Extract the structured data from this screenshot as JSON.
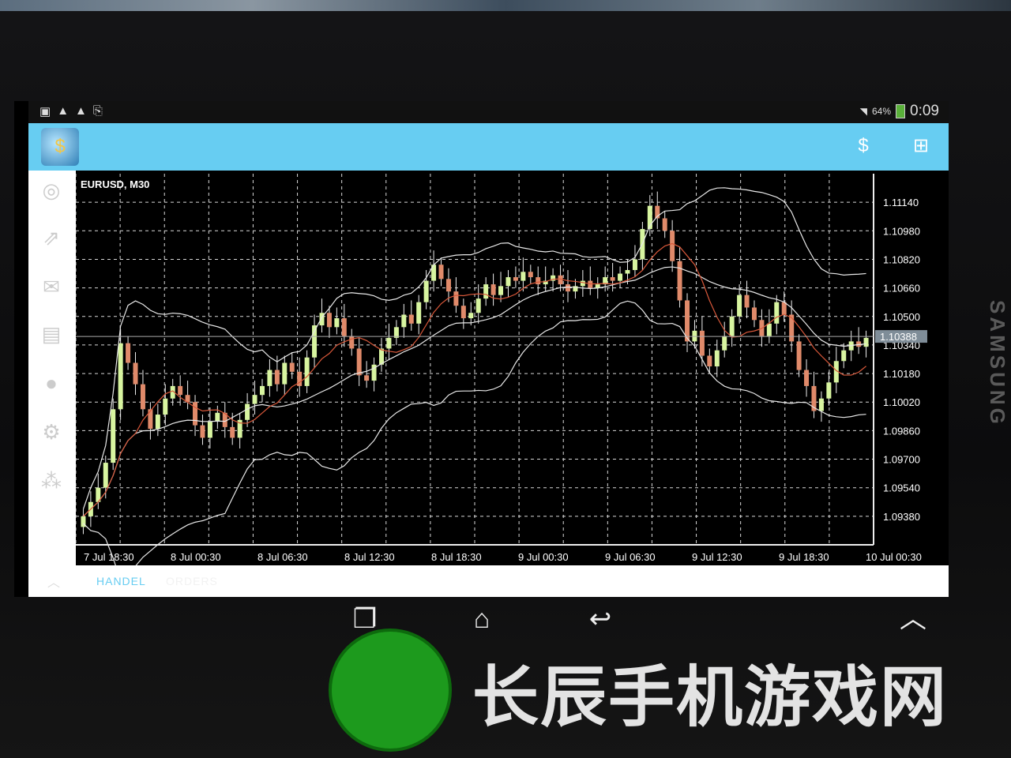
{
  "status_bar": {
    "battery": "64%",
    "time": "0:09"
  },
  "chart_data": {
    "type": "candlestick",
    "symbol_label": "EURUSD, M30",
    "y_ticks": [
      "1.11140",
      "1.10980",
      "1.10820",
      "1.10660",
      "1.10500",
      "1.10340",
      "1.10180",
      "1.10020",
      "1.09860",
      "1.09700",
      "1.09540",
      "1.09380"
    ],
    "x_ticks": [
      "7 Jul 18:30",
      "8 Jul 00:30",
      "8 Jul 06:30",
      "8 Jul 12:30",
      "8 Jul 18:30",
      "9 Jul 00:30",
      "9 Jul 06:30",
      "9 Jul 12:30",
      "9 Jul 18:30",
      "10 Jul 00:30"
    ],
    "current_price": "1.10388",
    "ylim": [
      1.0922,
      1.113
    ],
    "grid": true,
    "colors": {
      "bull": "#d8f5a0",
      "bear": "#e08a6a",
      "bands": "#e8e8e8",
      "ma": "#d9583a"
    },
    "close_prices": [
      1.0938,
      1.0946,
      1.0954,
      1.0968,
      1.0998,
      1.1035,
      1.1024,
      1.1012,
      1.0998,
      1.0987,
      1.0995,
      1.1004,
      1.1011,
      1.1006,
      1.1002,
      1.0989,
      1.0982,
      1.0991,
      1.0996,
      1.0988,
      1.0982,
      1.0992,
      1.1001,
      1.1006,
      1.1011,
      1.102,
      1.1012,
      1.1024,
      1.1019,
      1.1011,
      1.1027,
      1.1045,
      1.1052,
      1.1044,
      1.1049,
      1.1039,
      1.1032,
      1.1017,
      1.1014,
      1.1023,
      1.1032,
      1.1038,
      1.1044,
      1.1051,
      1.1046,
      1.1058,
      1.107,
      1.1079,
      1.1071,
      1.1064,
      1.1056,
      1.1049,
      1.1052,
      1.106,
      1.1068,
      1.1062,
      1.1067,
      1.1072,
      1.107,
      1.1075,
      1.1072,
      1.1068,
      1.107,
      1.1073,
      1.1068,
      1.1064,
      1.1067,
      1.107,
      1.1066,
      1.1068,
      1.1072,
      1.107,
      1.1074,
      1.1076,
      1.1082,
      1.1099,
      1.1112,
      1.1105,
      1.1098,
      1.1081,
      1.1059,
      1.1036,
      1.1042,
      1.1028,
      1.1022,
      1.1031,
      1.1039,
      1.105,
      1.1062,
      1.1055,
      1.1048,
      1.1039,
      1.1046,
      1.1058,
      1.1051,
      1.1036,
      1.102,
      1.1011,
      1.0997,
      1.1004,
      1.1013,
      1.1025,
      1.1031,
      1.1036,
      1.1033,
      1.1038
    ]
  },
  "bottom_tabs": [
    "HANDEL",
    "ORDERS"
  ],
  "brand": "SAMSUNG",
  "watermark": "长辰手机游戏网"
}
